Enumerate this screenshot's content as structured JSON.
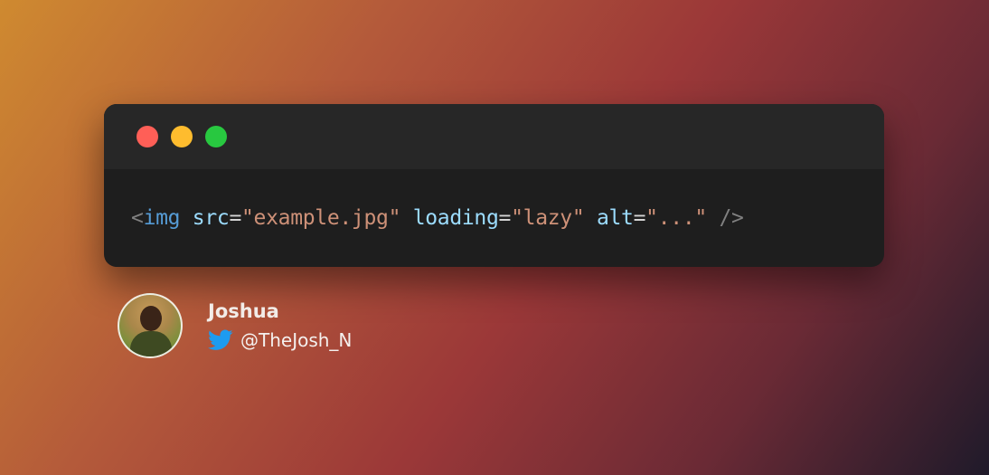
{
  "window": {
    "controls": [
      "close",
      "minimize",
      "maximize"
    ],
    "colors": {
      "close": "#ff5f57",
      "minimize": "#febc2e",
      "maximize": "#28c840",
      "background": "#1e1e1e",
      "titlebar": "#272727"
    }
  },
  "code": {
    "tokens": [
      {
        "text": "<",
        "kind": "punct"
      },
      {
        "text": "img",
        "kind": "tag"
      },
      {
        "text": " ",
        "kind": "space"
      },
      {
        "text": "src",
        "kind": "attr"
      },
      {
        "text": "=",
        "kind": "eq"
      },
      {
        "text": "\"example.jpg\"",
        "kind": "str"
      },
      {
        "text": " ",
        "kind": "space"
      },
      {
        "text": "loading",
        "kind": "attr"
      },
      {
        "text": "=",
        "kind": "eq"
      },
      {
        "text": "\"lazy\"",
        "kind": "str"
      },
      {
        "text": " ",
        "kind": "space"
      },
      {
        "text": "alt",
        "kind": "attr"
      },
      {
        "text": "=",
        "kind": "eq"
      },
      {
        "text": "\"...\"",
        "kind": "str"
      },
      {
        "text": " ",
        "kind": "space"
      },
      {
        "text": "/>",
        "kind": "punct"
      }
    ]
  },
  "author": {
    "name": "Joshua",
    "handle": "@TheJosh_N",
    "handle_icon": "twitter-icon",
    "twitter_color": "#1d9bf0"
  }
}
